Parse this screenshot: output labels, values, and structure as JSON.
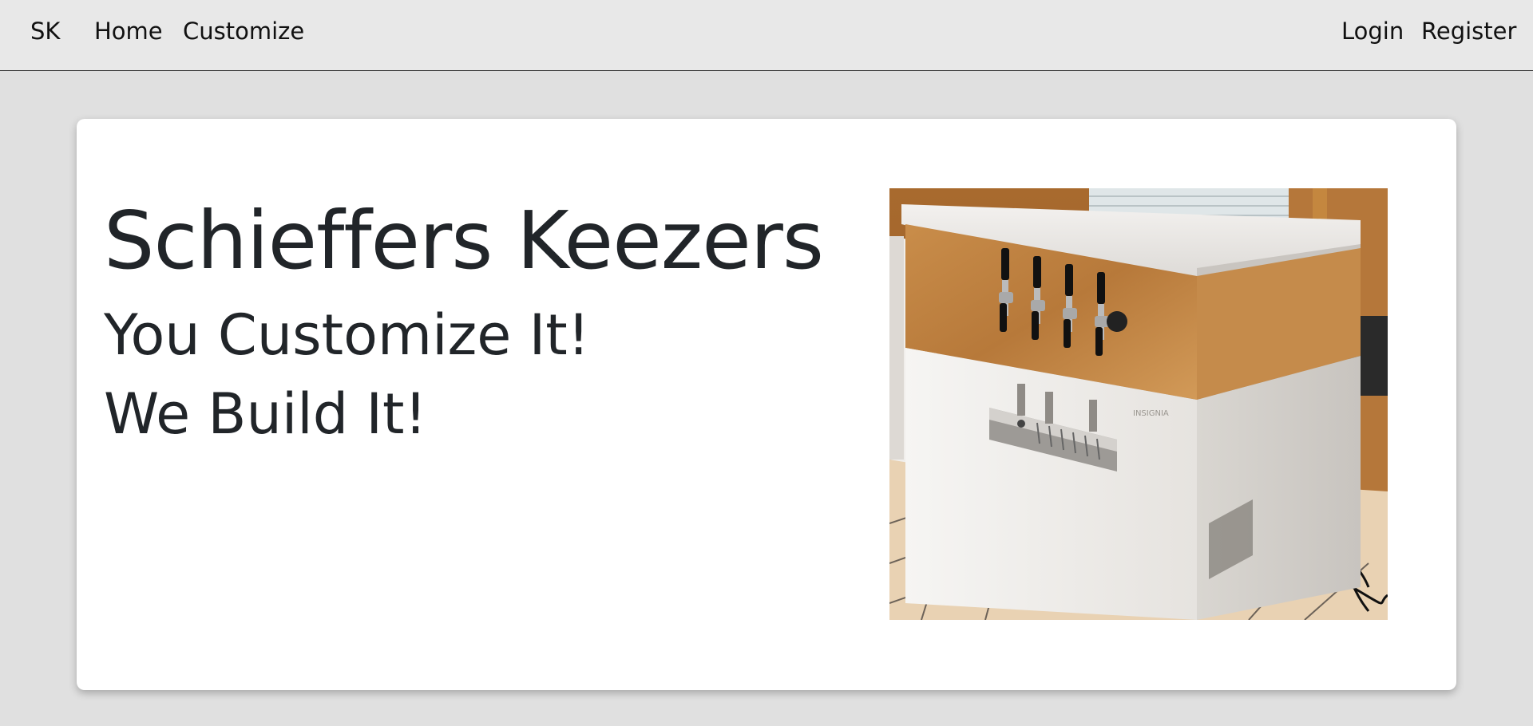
{
  "navbar": {
    "brand": "SK",
    "links": [
      "Home",
      "Customize"
    ],
    "auth": [
      "Login",
      "Register"
    ]
  },
  "hero": {
    "title": "Schieffers Keezers",
    "lines": [
      "You Customize It!",
      "We Build It!"
    ],
    "image_label": "INSIGNIA"
  },
  "colors": {
    "page_background": "#e0e0e0",
    "navbar_background": "#e8e8e8",
    "card_background": "#ffffff",
    "heading_text": "#212529"
  }
}
